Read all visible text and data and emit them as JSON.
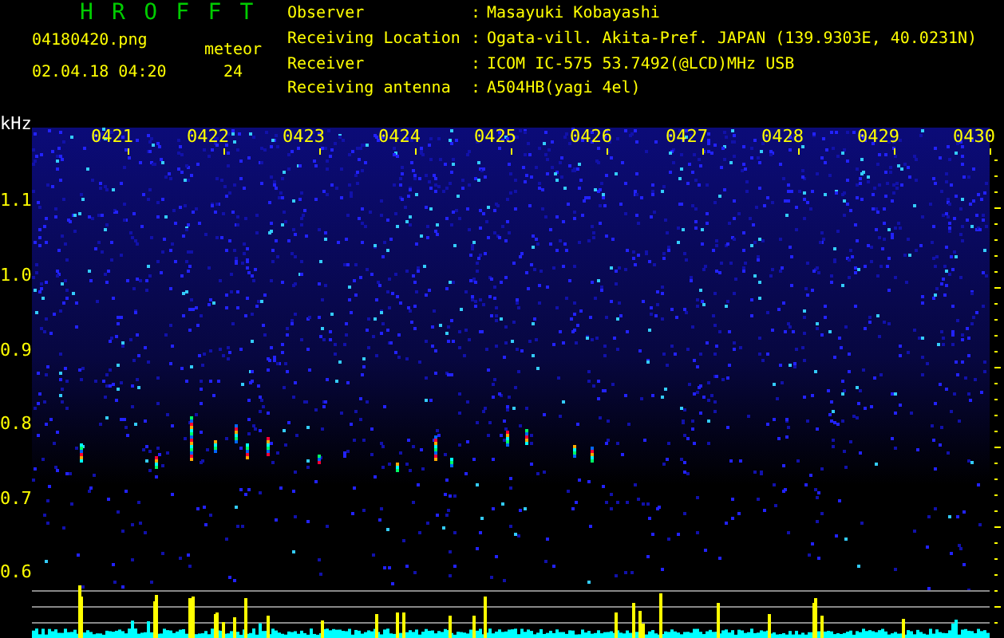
{
  "header": {
    "title": "H R O F F T",
    "file_name": "04180420.png",
    "date_time": "02.04.18 04:20",
    "count_label": "meteor",
    "count": "24"
  },
  "station_info": [
    {
      "label": "Observer",
      "separator": ":",
      "value": "Masayuki Kobayashi"
    },
    {
      "label": "Receiving Location",
      "separator": ":",
      "value": "Ogata-vill. Akita-Pref. JAPAN (139.9303E, 40.0231N)"
    },
    {
      "label": "Receiver",
      "separator": ":",
      "value": "ICOM IC-575 53.7492(@LCD)MHz USB"
    },
    {
      "label": "Receiving antenna",
      "separator": ":",
      "value": "A504HB(yagi 4el)"
    }
  ],
  "spectrogram": {
    "y_unit": "kHz",
    "y_labels": [
      "1.1",
      "1.0",
      "0.9",
      "0.8",
      "0.7",
      "0.6"
    ],
    "time_labels": [
      "0421",
      "0422",
      "0423",
      "0424",
      "0425",
      "0426",
      "0427",
      "0428",
      "0429",
      "0430"
    ]
  }
}
